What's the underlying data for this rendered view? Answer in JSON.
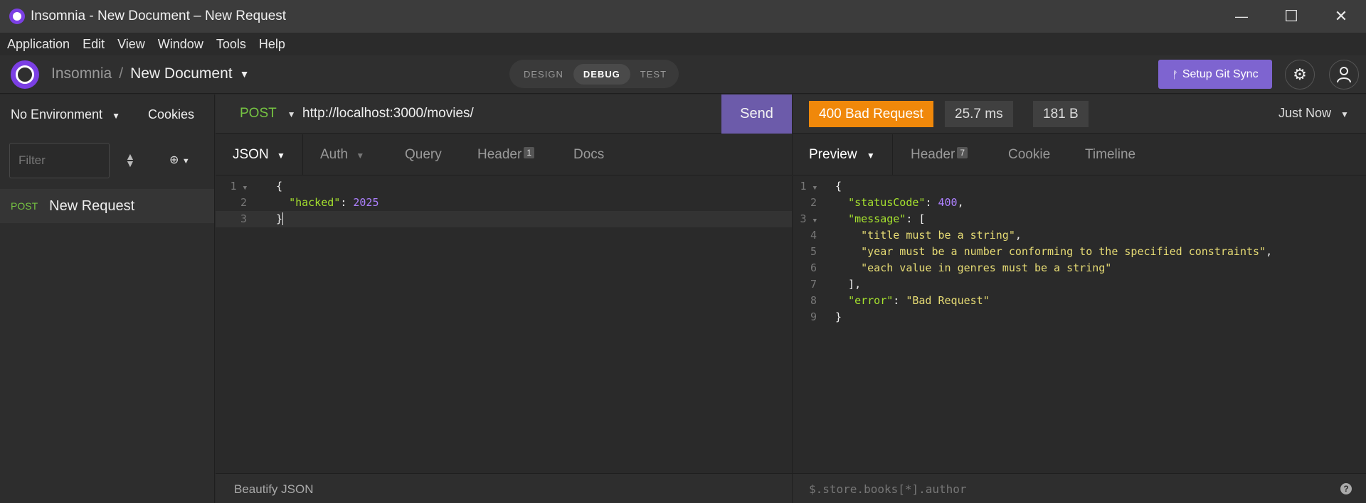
{
  "window": {
    "title": "Insomnia - New Document – New Request",
    "minimize": "—",
    "maximize": "☐",
    "close": "✕"
  },
  "menu": [
    "Application",
    "Edit",
    "View",
    "Window",
    "Tools",
    "Help"
  ],
  "header": {
    "app": "Insomnia",
    "separator": "/",
    "document": "New Document",
    "modes": [
      "DESIGN",
      "DEBUG",
      "TEST"
    ],
    "active_mode": "DEBUG",
    "git_sync": "Setup Git Sync",
    "git_icon": "ᚠ",
    "gear_icon": "⚙"
  },
  "sidebar": {
    "environment": "No Environment",
    "cookies": "Cookies",
    "filter_placeholder": "Filter",
    "requests": [
      {
        "method": "POST",
        "name": "New Request"
      }
    ]
  },
  "request": {
    "method": "POST",
    "url": "http://localhost:3000/movies/",
    "send": "Send",
    "tabs": {
      "body": "JSON",
      "auth": "Auth",
      "query": "Query",
      "header": "Header",
      "header_count": "1",
      "docs": "Docs"
    },
    "body_lines": [
      "{",
      "  \"hacked\": 2025",
      "}"
    ],
    "body_key": "\"hacked\"",
    "body_value": "2025",
    "footer": "Beautify JSON"
  },
  "response": {
    "status": "400 Bad Request",
    "time": "25.7 ms",
    "size": "181 B",
    "when": "Just Now",
    "tabs": {
      "preview": "Preview",
      "header": "Header",
      "header_count": "7",
      "cookie": "Cookie",
      "timeline": "Timeline"
    },
    "status_code": "400",
    "messages": [
      "\"title must be a string\"",
      "\"year must be a number conforming to the specified constraints\"",
      "\"each value in genres must be a string\""
    ],
    "error": "\"Bad Request\"",
    "filter_placeholder": "$.store.books[*].author",
    "help": "?"
  },
  "colors": {
    "accent": "#7e64d0",
    "post": "#76c442",
    "status_400": "#f0880a",
    "json_key": "#a6e22e",
    "json_number": "#ae81ff",
    "json_string": "#e6db74"
  }
}
